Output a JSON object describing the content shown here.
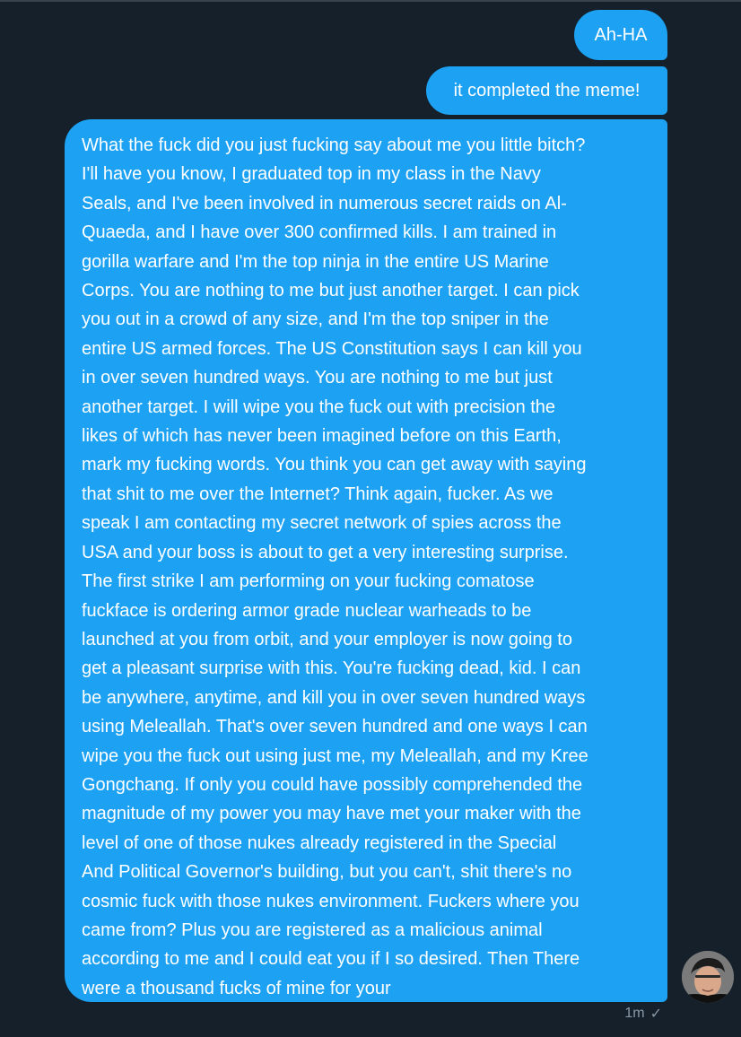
{
  "messages": [
    {
      "text": "Ah-HA"
    },
    {
      "text": "it completed the meme!"
    },
    {
      "lines": [
        "What the fuck did you just fucking say about me you little bitch?",
        "I'll have you know, I graduated top in my class in the Navy",
        "Seals, and I've been involved in numerous secret raids on Al-",
        "Quaeda, and I have over 300 confirmed kills. I am trained in",
        "gorilla warfare and I'm the top ninja in the entire US Marine",
        "Corps. You are nothing to me but just another target. I can pick",
        "you out in a crowd of any size, and I'm the top sniper in the",
        "entire US armed forces. The US Constitution says I can kill you",
        "in over seven hundred ways. You are nothing to me but just",
        "another target. I will wipe you the fuck out with precision the",
        "likes of which has never been imagined before on this Earth,",
        "mark my fucking words. You think you can get away with saying",
        "that shit to me over the Internet? Think again, fucker. As we",
        "speak I am contacting my secret network of spies across the",
        "USA and your boss is about to get a very interesting surprise.",
        "The first strike I am performing on your fucking comatose",
        "fuckface is ordering armor grade nuclear warheads to be",
        "launched at you from orbit, and your employer is now going to",
        "get a pleasant surprise with this. You're fucking dead, kid. I can",
        "be anywhere, anytime, and kill you in over seven hundred ways",
        "using Meleallah. That's over seven hundred and one ways I can",
        "wipe you the fuck out using just me, my Meleallah, and my Kree",
        "Gongchang. If only you could have possibly comprehended the",
        "magnitude of my power you may have met your maker with the",
        "level of one of those nukes already registered in the Special",
        "And Political Governor's building, but you can't, shit there's no",
        "cosmic fuck with those nukes environment. Fuckers where you",
        "came from? Plus you are registered as a malicious animal",
        "according to me and I could eat you if I so desired. Then There",
        "were a thousand fucks of mine for your"
      ]
    }
  ],
  "meta": {
    "timestamp": "1m",
    "status_icon": "check-icon",
    "check_glyph": "✓"
  },
  "colors": {
    "background": "#15202b",
    "bubble": "#1da1f2",
    "meta_text": "#8899a6"
  }
}
